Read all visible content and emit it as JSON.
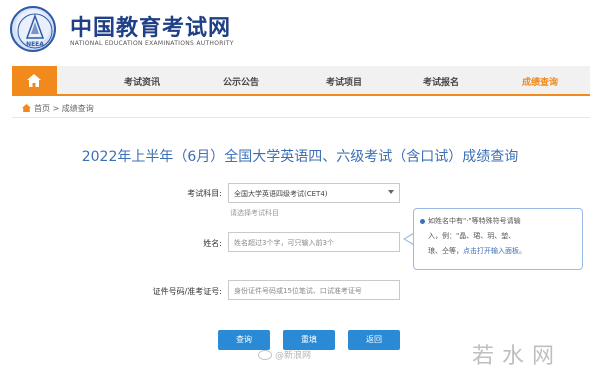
{
  "header": {
    "site_title": "中国教育考试网",
    "site_subtitle": "NATIONAL EDUCATION EXAMINATIONS AUTHORITY",
    "logo_text": "NEEA"
  },
  "nav": {
    "items": [
      "考试资讯",
      "公示公告",
      "考试项目",
      "考试报名",
      "成绩查询"
    ],
    "active_index": 4,
    "accent_color": "#f08a1c"
  },
  "breadcrumb": {
    "home": "首页",
    "separator": ">",
    "current": "成绩查询"
  },
  "title": "2022年上半年（6月）全国大学英语四、六级考试（含口试）成绩查询",
  "form": {
    "subject_label": "考试科目:",
    "subject_value": "全国大学英语四级考试(CET4)",
    "subject_hint": "请选择考试科目",
    "name_label": "姓名:",
    "name_placeholder": "姓名超过3个字，可只输入前3个",
    "id_label": "证件号码/准考证号:",
    "id_placeholder": "身份证件号码或15位笔试、口试准考证号"
  },
  "tooltip": {
    "line1": "如姓名中有\"·\"等特殊符号请输",
    "line2": "入，例：\"晶、珺、玥、堃、",
    "line3_prefix": "琅、仝等，",
    "line3_link": "点击打开输入面板。"
  },
  "buttons": {
    "query": "查询",
    "reset": "重填",
    "back": "返回"
  },
  "watermarks": {
    "weibo": "@新浪网",
    "corner": "若水网"
  },
  "colors": {
    "brand_blue": "#1f3f86",
    "title_blue": "#3c6fb5",
    "button_blue": "#2a8ad6",
    "nav_orange": "#f08a1c"
  }
}
